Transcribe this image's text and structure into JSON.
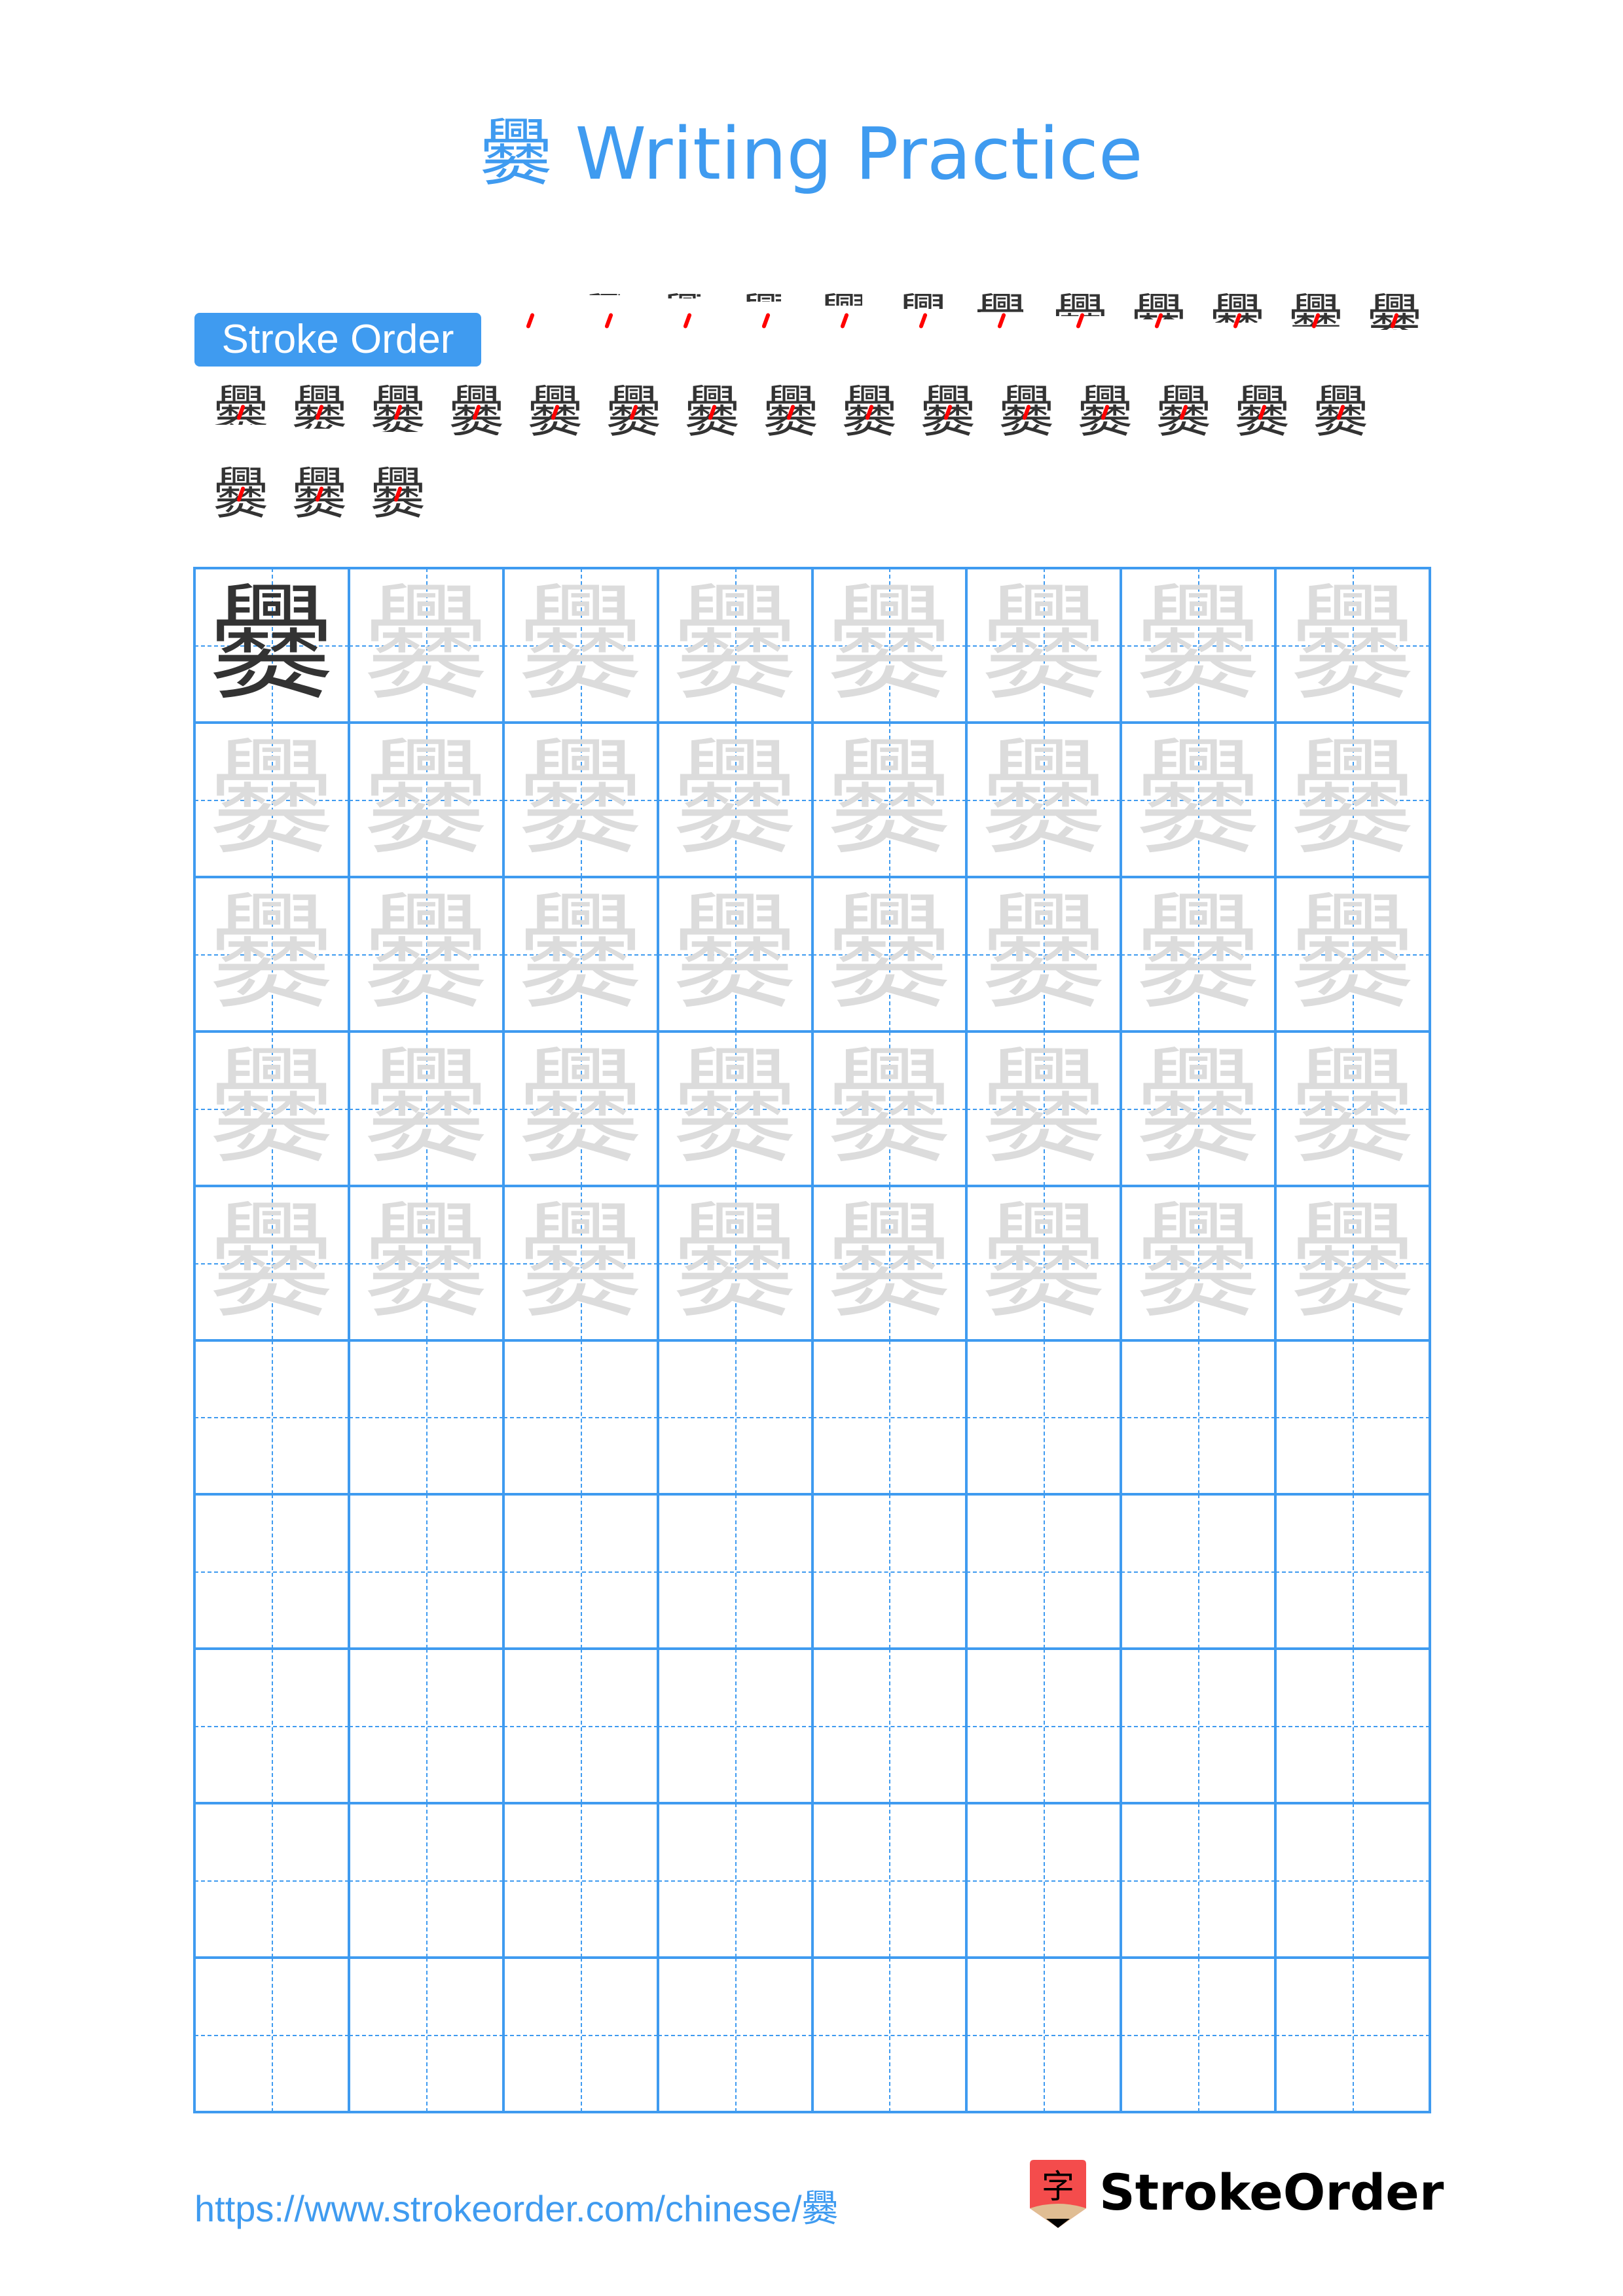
{
  "title": {
    "character": "爨",
    "suffix": " Writing Practice"
  },
  "stroke_order": {
    "label": "Stroke Order",
    "total_strokes": 30,
    "character": "爨",
    "rows": [
      [
        1,
        2,
        3,
        4,
        5,
        6,
        7,
        8,
        9,
        10,
        11,
        12
      ],
      [
        13,
        14,
        15,
        16,
        17,
        18,
        19,
        20,
        21,
        22,
        23,
        24,
        25,
        26,
        27
      ],
      [
        28,
        29,
        30
      ]
    ],
    "current_stroke_color": "#ff0000",
    "done_stroke_color": "#333333"
  },
  "practice_grid": {
    "character": "爨",
    "columns": 8,
    "rows": 10,
    "model_cells": 1,
    "trace_rows": 5,
    "empty_rows": 5,
    "line_color": "#3f9bf0",
    "trace_color": "#dcdcdc",
    "model_color": "#333333"
  },
  "footer": {
    "url": "https://www.strokeorder.com/chinese/爨",
    "logo_char": "字",
    "brand": "StrokeOrder"
  }
}
